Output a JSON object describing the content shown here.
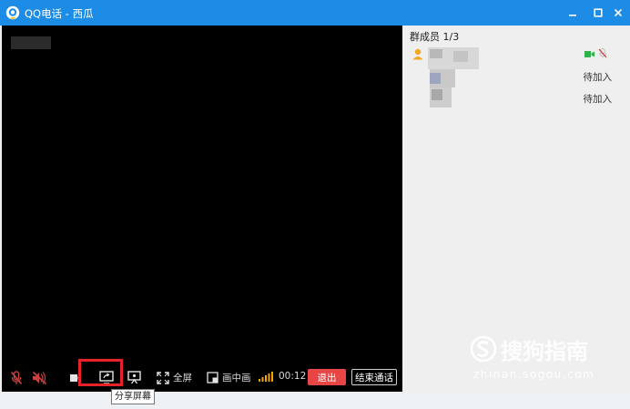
{
  "window": {
    "title": "QQ电话 - 西瓜",
    "controls": {
      "minimize": "minimize-icon",
      "maximize": "maximize-icon",
      "close": "close-icon"
    }
  },
  "toolbar": {
    "fullscreen_label": "全屏",
    "pip_label": "画中画",
    "timer": "00:12",
    "exit_label": "退出",
    "end_call_label": "结束通话",
    "share_screen_tooltip": "分享屏幕"
  },
  "sidebar": {
    "header": "群成员 1/3",
    "members": [
      {
        "status": "",
        "mic": "muted",
        "camera": "on"
      },
      {
        "status": "待加入"
      },
      {
        "status": "待加入"
      }
    ]
  },
  "watermark": {
    "brand": "搜狗指南",
    "url": "zhinan.sogou.com"
  },
  "colors": {
    "titlebar": "#1c8ce6",
    "exit_button": "#e84545",
    "highlight": "#e8222a",
    "signal": "#f0a500",
    "camera_on": "#2fb24c",
    "muted": "#d23b3b"
  }
}
